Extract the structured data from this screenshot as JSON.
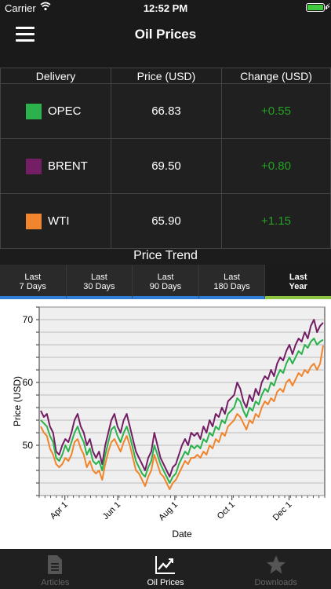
{
  "status_bar": {
    "carrier": "Carrier",
    "time": "12:52 PM"
  },
  "nav": {
    "title": "Oil Prices"
  },
  "table": {
    "headers": [
      "Delivery",
      "Price (USD)",
      "Change (USD)"
    ],
    "rows": [
      {
        "name": "OPEC",
        "color": "#2bb24c",
        "price": "66.83",
        "change": "+0.55"
      },
      {
        "name": "BRENT",
        "color": "#741e65",
        "price": "69.50",
        "change": "+0.80"
      },
      {
        "name": "WTI",
        "color": "#f0852d",
        "price": "65.90",
        "change": "+1.15"
      }
    ]
  },
  "trend": {
    "title": "Price Trend",
    "tabs": [
      {
        "line1": "Last",
        "line2": "7 Days"
      },
      {
        "line1": "Last",
        "line2": "30 Days"
      },
      {
        "line1": "Last",
        "line2": "90 Days"
      },
      {
        "line1": "Last",
        "line2": "180 Days"
      },
      {
        "line1": "Last",
        "line2": "Year",
        "active": true
      }
    ]
  },
  "chart_data": {
    "type": "line",
    "xlabel": "Date",
    "ylabel": "Price (USD)",
    "ylim": [
      42,
      72
    ],
    "yticks": [
      50,
      60,
      70
    ],
    "x_ticks": [
      "Apr 1",
      "Jun 1",
      "Aug 1",
      "Oct 1",
      "Dec 1"
    ],
    "x_tick_fraction": [
      0.09,
      0.275,
      0.475,
      0.675,
      0.875
    ],
    "grid": true,
    "series": [
      {
        "name": "BRENT",
        "color": "#741e65",
        "values": [
          55.5,
          54.5,
          55,
          53,
          52,
          49,
          48.5,
          50,
          51,
          50.5,
          52,
          54,
          55,
          53,
          52,
          50,
          51,
          49,
          48,
          49,
          47,
          50,
          52,
          54,
          55,
          53,
          52,
          54,
          55,
          53,
          51,
          49,
          48,
          47,
          46,
          48,
          49,
          52,
          50,
          48,
          47,
          46,
          45,
          46.5,
          47,
          48.5,
          50,
          51,
          50,
          52,
          51.5,
          52,
          51,
          53,
          52,
          54,
          53,
          55,
          54.5,
          56,
          55,
          57,
          57.5,
          58,
          60,
          59,
          57,
          56,
          58,
          57,
          59,
          58,
          60,
          61,
          60.5,
          62,
          61,
          63,
          64,
          63.5,
          65,
          66,
          64.5,
          66,
          67,
          66.5,
          68,
          67,
          69,
          70,
          68,
          69,
          69.5
        ]
      },
      {
        "name": "OPEC",
        "color": "#2bb24c",
        "values": [
          54,
          53.5,
          53,
          51.5,
          50.5,
          48,
          47.5,
          48.5,
          50,
          49,
          50.5,
          52,
          53,
          51.5,
          50.5,
          48.5,
          49.5,
          47.5,
          47,
          47.5,
          46,
          48.5,
          50.5,
          52.5,
          53,
          51.5,
          50.5,
          52,
          53,
          51.5,
          49.5,
          47.5,
          46.5,
          45.5,
          45,
          46.5,
          47.5,
          50,
          48.5,
          47,
          46,
          45,
          44,
          45,
          45.5,
          47,
          48,
          49,
          48.5,
          50,
          49.5,
          50,
          49.5,
          51,
          50.5,
          52,
          51.5,
          53,
          52.5,
          54,
          53.5,
          55,
          55.5,
          56,
          57.5,
          57,
          55.5,
          54.5,
          56,
          55.5,
          57,
          56.5,
          58,
          59,
          58.5,
          60,
          59.5,
          61,
          62,
          61.5,
          63,
          64,
          63,
          64,
          65,
          64.5,
          66,
          65.5,
          66.5,
          67,
          66,
          66.5,
          66.8
        ]
      },
      {
        "name": "WTI",
        "color": "#f0852d",
        "values": [
          53,
          52,
          51.5,
          49.5,
          48.5,
          47,
          46.5,
          47,
          48,
          47.5,
          48.5,
          50.5,
          51,
          49.5,
          48.5,
          46.5,
          47.5,
          46,
          45.5,
          46,
          44.5,
          47,
          49,
          50.5,
          51,
          50,
          49,
          50.5,
          51.5,
          50,
          48,
          46,
          45.5,
          44.5,
          43.5,
          45,
          46,
          48.5,
          47,
          45.5,
          45,
          44,
          43,
          44,
          44.5,
          45.5,
          46.5,
          47.5,
          47,
          48,
          48,
          48.5,
          48,
          49,
          48.5,
          50,
          49.5,
          51,
          50.5,
          52,
          51.5,
          53,
          53.5,
          54,
          55,
          54.5,
          53.5,
          52.5,
          54,
          53.5,
          55,
          54.5,
          56,
          57,
          56.5,
          57.5,
          57,
          58.5,
          59,
          58.5,
          60,
          60.5,
          59.5,
          60.5,
          61.5,
          61,
          62,
          61.5,
          62.5,
          63,
          62,
          63,
          65.9
        ]
      }
    ]
  },
  "tab_bar": {
    "items": [
      {
        "label": "Articles",
        "icon": "document-icon"
      },
      {
        "label": "Oil Prices",
        "icon": "chart-icon",
        "active": true
      },
      {
        "label": "Downloads",
        "icon": "star-icon"
      }
    ]
  }
}
